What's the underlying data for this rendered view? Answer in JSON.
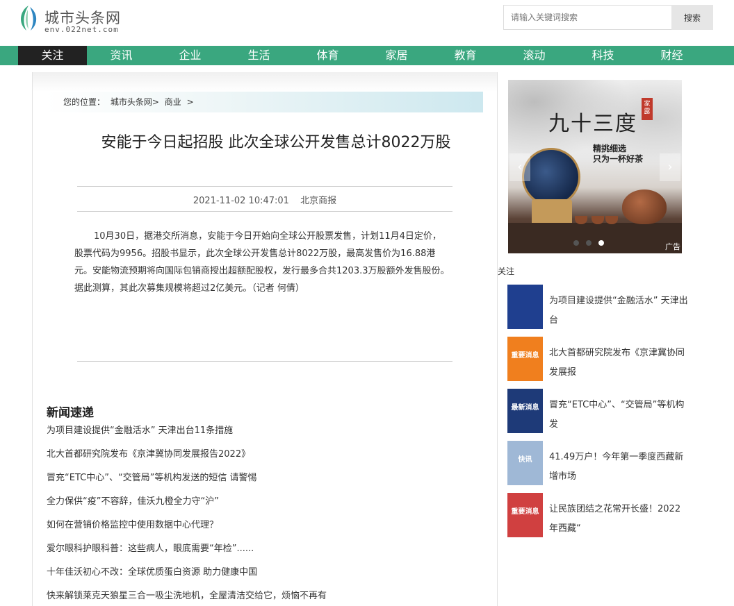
{
  "site": {
    "title": "城市头条网",
    "url": "env.022net.com"
  },
  "search": {
    "placeholder": "请输入关键词搜索",
    "button_label": "搜索"
  },
  "nav": [
    {
      "label": "关注",
      "active": true
    },
    {
      "label": "资讯"
    },
    {
      "label": "企业"
    },
    {
      "label": "生活"
    },
    {
      "label": "体育"
    },
    {
      "label": "家居"
    },
    {
      "label": "教育"
    },
    {
      "label": "滚动"
    },
    {
      "label": "科技"
    },
    {
      "label": "财经"
    }
  ],
  "breadcrumb": {
    "prefix": "您的位置：",
    "items": [
      "城市头条网>",
      "商业",
      ">"
    ]
  },
  "article": {
    "title": "安能于今日起招股 此次全球公开发售总计8022万股",
    "datetime": "2021-11-02 10:47:01",
    "source": "北京商报",
    "body": "10月30日，据港交所消息，安能于今日开始向全球公开股票发售，计划11月4日定价，股票代码为9956。招股书显示，此次全球公开发售总计8022万股，最高发售价为16.88港元。安能物流预期将向国际包销商授出超额配股权，发行最多合共1203.3万股额外发售股份。据此测算，其此次募集规模将超过2亿美元。（记者 何倩）"
  },
  "news_section": {
    "heading": "新闻速递",
    "items": [
      "为项目建设提供“金融活水” 天津出台11条措施",
      "北大首都研究院发布《京津冀协同发展报告2022》",
      "冒充“ETC中心”、“交管局”等机构发送的短信 请警惕",
      "全力保供“疫”不容辞，佳沃九橙全力守“沪”",
      "如何在营销价格监控中使用数据中心代理？",
      "爱尔眼科护眼科普：这些病人，眼底需要“年检”......",
      "十年佳沃初心不改：全球优质蛋白资源 助力健康中国",
      "快来解锁莱克天狼星三合一吸尘洗地机，全屋清洁交给它，烦恼不再有"
    ]
  },
  "banner": {
    "title": "九十三度",
    "seal": "家露",
    "slogan_line1": "精挑细选",
    "slogan_line2": "只为一杯好茶",
    "ad_label": "广告",
    "prev_icon": "chevron-left-icon",
    "next_icon": "chevron-right-icon",
    "slides": 3,
    "active_slide": 3
  },
  "sidebar": {
    "heading": "关注",
    "items": [
      {
        "text": "为项目建设提供“金融活水” 天津出台",
        "thumb_color": "#1f3f8f",
        "thumb_label": ""
      },
      {
        "text": "北大首都研究院发布《京津冀协同发展报",
        "thumb_color": "#f07f1e",
        "thumb_label": "重要消息"
      },
      {
        "text": "冒充“ETC中心”、“交管局”等机构发",
        "thumb_color": "#1e3a78",
        "thumb_label": "最新消息"
      },
      {
        "text": "41.49万户！今年第一季度西藏新增市场",
        "thumb_color": "#9fb8d6",
        "thumb_label": "快讯"
      },
      {
        "text": "让民族团结之花常开长盛！2022年西藏“",
        "thumb_color": "#d04040",
        "thumb_label": "重要消息"
      }
    ]
  },
  "colors": {
    "nav_bg": "#3aa77f",
    "nav_active_bg": "#222222",
    "search_btn_bg": "#e6e6e6"
  }
}
